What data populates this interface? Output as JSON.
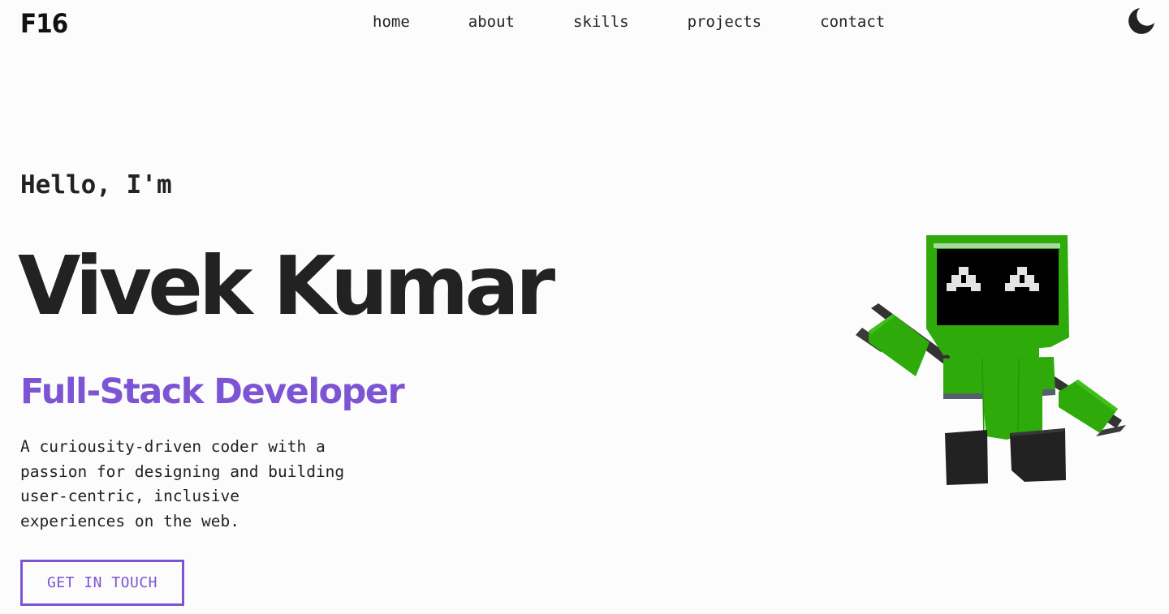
{
  "header": {
    "logo": "F16",
    "nav": [
      "home",
      "about",
      "skills",
      "projects",
      "contact"
    ],
    "theme_toggle_icon": "moon-icon"
  },
  "hero": {
    "greeting": "Hello, I'm",
    "name": "Vivek Kumar",
    "role": "Full-Stack Developer",
    "description": "A curiousity-driven coder with a passion for designing and building user-centric, inclusive experiences on the web.",
    "cta_label": "GET IN TOUCH",
    "illustration_icon": "robot-icon"
  },
  "colors": {
    "accent": "#7d55d4",
    "text": "#222222",
    "background": "#fcfcfc",
    "robot_green": "#2eaa0a",
    "robot_dark": "#222222"
  }
}
